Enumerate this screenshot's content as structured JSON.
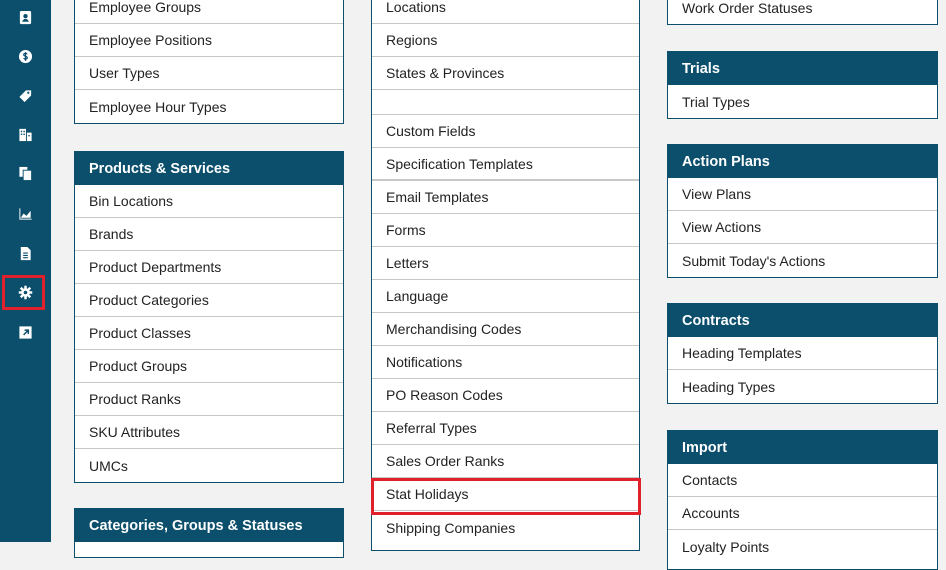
{
  "sidebar": {
    "icons": [
      "contacts-icon",
      "dollar-icon",
      "tag-icon",
      "building-icon",
      "documents-icon",
      "chart-icon",
      "file-icon",
      "gear-icon",
      "external-link-icon"
    ]
  },
  "col1": {
    "top_items": [
      "Employee Groups",
      "Employee Positions",
      "User Types",
      "Employee Hour Types"
    ],
    "products": {
      "title": "Products & Services",
      "items": [
        "Bin Locations",
        "Brands",
        "Product Departments",
        "Product Categories",
        "Product Classes",
        "Product Groups",
        "Product Ranks",
        "SKU Attributes",
        "UMCs"
      ]
    },
    "categories": {
      "title": "Categories, Groups & Statuses"
    }
  },
  "col2": {
    "items": [
      "Locations",
      "Regions",
      "States & Provinces",
      "",
      "Custom Fields",
      "Specification Templates",
      "Email Templates",
      "Forms",
      "Letters",
      "Language",
      "Merchandising Codes",
      "Notifications",
      "PO Reason Codes",
      "Referral Types",
      "Sales Order Ranks",
      "Stat Holidays",
      "Shipping Companies"
    ]
  },
  "col3": {
    "top_items": [
      "Work Order Statuses"
    ],
    "trials": {
      "title": "Trials",
      "items": [
        "Trial Types"
      ]
    },
    "action_plans": {
      "title": "Action Plans",
      "items": [
        "View Plans",
        "View Actions",
        "Submit Today's Actions"
      ]
    },
    "contracts": {
      "title": "Contracts",
      "items": [
        "Heading Templates",
        "Heading Types"
      ]
    },
    "import": {
      "title": "Import",
      "items": [
        "Contacts",
        "Accounts",
        "Loyalty Points"
      ]
    }
  },
  "colors": {
    "primary": "#0b4f6c",
    "highlight": "#e0202a",
    "background": "#f2f2f2"
  }
}
